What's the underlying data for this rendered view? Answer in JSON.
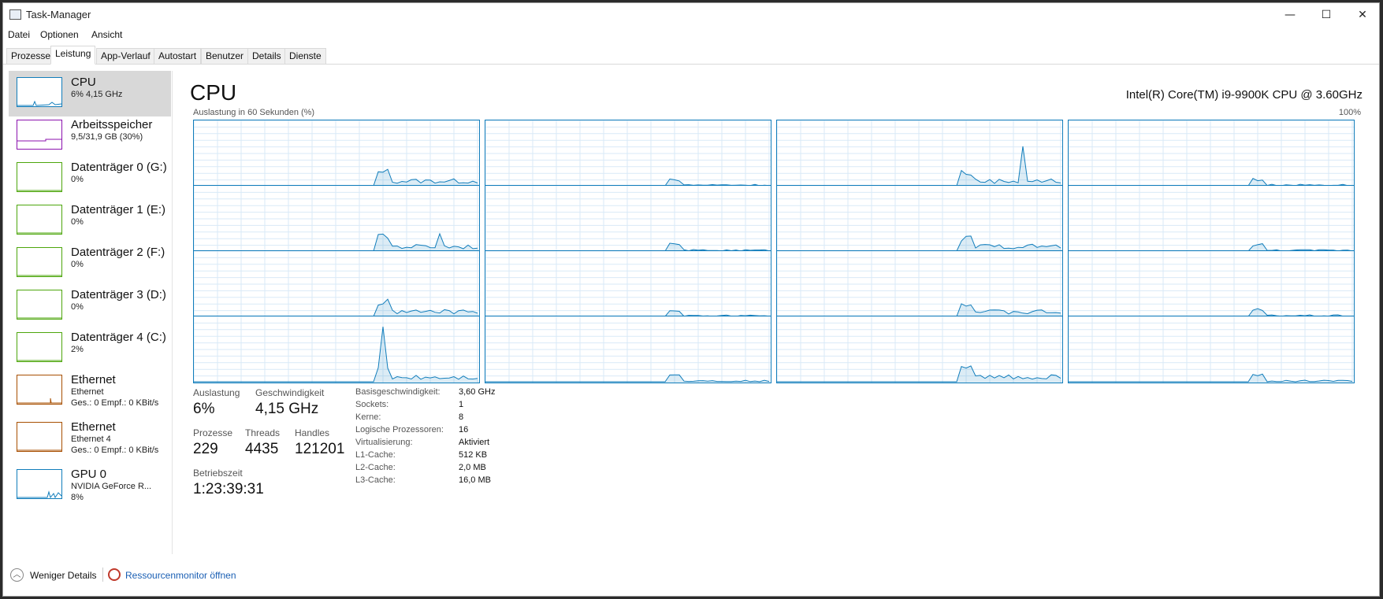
{
  "window": {
    "title": "Task-Manager",
    "controls": {
      "minimize": "—",
      "maximize": "☐",
      "close": "✕"
    }
  },
  "menu": [
    "Datei",
    "Optionen",
    "Ansicht"
  ],
  "tabs": [
    {
      "label": "Prozesse",
      "active": false
    },
    {
      "label": "Leistung",
      "active": true
    },
    {
      "label": "App-Verlauf",
      "active": false
    },
    {
      "label": "Autostart",
      "active": false
    },
    {
      "label": "Benutzer",
      "active": false
    },
    {
      "label": "Details",
      "active": false
    },
    {
      "label": "Dienste",
      "active": false
    }
  ],
  "sidebar": {
    "items": [
      {
        "name": "CPU",
        "sub1": "6% 4,15 GHz",
        "sub2": "",
        "color": "#117dbb",
        "icon": "cpu-graph-thumbnail",
        "selected": true
      },
      {
        "name": "Arbeitsspeicher",
        "sub1": "9,5/31,9 GB (30%)",
        "sub2": "",
        "color": "#8b12ae",
        "icon": "memory-graph-thumbnail",
        "selected": false
      },
      {
        "name": "Datenträger 0 (G:)",
        "sub1": "0%",
        "sub2": "",
        "color": "#4da60c",
        "icon": "disk-graph-thumbnail",
        "selected": false
      },
      {
        "name": "Datenträger 1 (E:)",
        "sub1": "0%",
        "sub2": "",
        "color": "#4da60c",
        "icon": "disk-graph-thumbnail",
        "selected": false
      },
      {
        "name": "Datenträger 2 (F:)",
        "sub1": "0%",
        "sub2": "",
        "color": "#4da60c",
        "icon": "disk-graph-thumbnail",
        "selected": false
      },
      {
        "name": "Datenträger 3 (D:)",
        "sub1": "0%",
        "sub2": "",
        "color": "#4da60c",
        "icon": "disk-graph-thumbnail",
        "selected": false
      },
      {
        "name": "Datenträger 4 (C:)",
        "sub1": "2%",
        "sub2": "",
        "color": "#4da60c",
        "icon": "disk-graph-thumbnail",
        "selected": false
      },
      {
        "name": "Ethernet",
        "sub1": "Ethernet",
        "sub2": "Ges.: 0 Empf.: 0 KBit/s",
        "color": "#a74f01",
        "icon": "network-graph-thumbnail",
        "selected": false
      },
      {
        "name": "Ethernet",
        "sub1": "Ethernet 4",
        "sub2": "Ges.: 0 Empf.: 0 KBit/s",
        "color": "#a74f01",
        "icon": "network-graph-thumbnail",
        "selected": false
      },
      {
        "name": "GPU 0",
        "sub1": "NVIDIA GeForce R...",
        "sub2": "8%",
        "color": "#117dbb",
        "icon": "gpu-graph-thumbnail",
        "selected": false
      }
    ]
  },
  "main": {
    "title": "CPU",
    "cpu_model": "Intel(R) Core(TM) i9-9900K CPU @ 3.60GHz",
    "graph_label": "Auslastung in 60 Sekunden (%)",
    "graph_max": "100%",
    "graph_color": "#117dbb",
    "stats": {
      "auslastung_label": "Auslastung",
      "auslastung_value": "6%",
      "geschwindigkeit_label": "Geschwindigkeit",
      "geschwindigkeit_value": "4,15 GHz",
      "prozesse_label": "Prozesse",
      "prozesse_value": "229",
      "threads_label": "Threads",
      "threads_value": "4435",
      "handles_label": "Handles",
      "handles_value": "121201",
      "betriebszeit_label": "Betriebszeit",
      "betriebszeit_value": "1:23:39:31"
    },
    "specs": [
      {
        "label": "Basisgeschwindigkeit:",
        "value": "3,60 GHz"
      },
      {
        "label": "Sockets:",
        "value": "1"
      },
      {
        "label": "Kerne:",
        "value": "8"
      },
      {
        "label": "Logische Prozessoren:",
        "value": "16"
      },
      {
        "label": "Virtualisierung:",
        "value": "Aktiviert"
      },
      {
        "label": "L1-Cache:",
        "value": "512 KB"
      },
      {
        "label": "L2-Cache:",
        "value": "2,0 MB"
      },
      {
        "label": "L3-Cache:",
        "value": "16,0 MB"
      }
    ]
  },
  "footer": {
    "fewer_details": "Weniger Details",
    "resource_monitor": "Ressourcenmonitor öffnen"
  }
}
